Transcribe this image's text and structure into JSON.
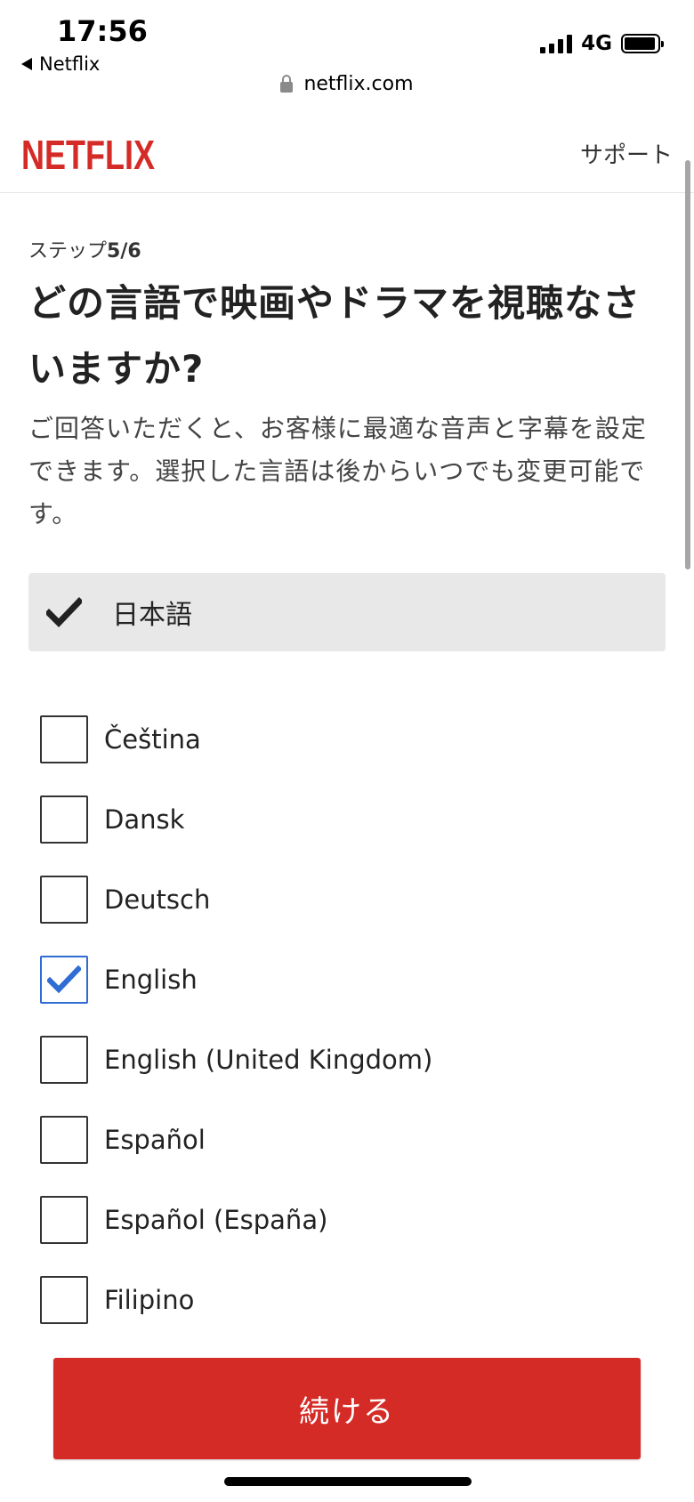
{
  "status_bar": {
    "time": "17:56",
    "back_app": "Netflix",
    "network": "4G",
    "url": "netflix.com",
    "icons": [
      "back-triangle-icon",
      "signal-icon",
      "battery-icon",
      "lock-icon"
    ]
  },
  "header": {
    "logo_text": "NETFLIX",
    "support_label": "サポート"
  },
  "colors": {
    "brand_red": "#d52b27",
    "checkbox_checked": "#2f6cd3",
    "primary_bg": "#e8e8e8"
  },
  "main": {
    "step_prefix": "ステップ",
    "step_value": "5/6",
    "title": "どの言語で映画やドラマを視聴なさいますか?",
    "description": "ご回答いただくと、お客様に最適な音声と字幕を設定できます。選択した言語は後からいつでも変更可能です。",
    "primary_language": {
      "label": "日本語",
      "checked": true
    },
    "languages": [
      {
        "label": "Čeština",
        "checked": false
      },
      {
        "label": "Dansk",
        "checked": false
      },
      {
        "label": "Deutsch",
        "checked": false
      },
      {
        "label": "English",
        "checked": true
      },
      {
        "label": "English (United Kingdom)",
        "checked": false
      },
      {
        "label": "Español",
        "checked": false
      },
      {
        "label": "Español (España)",
        "checked": false
      },
      {
        "label": "Filipino",
        "checked": false
      }
    ],
    "continue_label": "続ける"
  }
}
